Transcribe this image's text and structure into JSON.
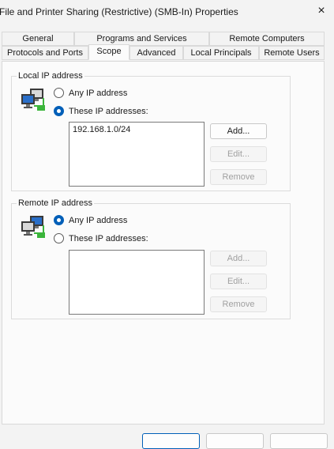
{
  "window": {
    "title": "File and Printer Sharing (Restrictive) (SMB-In) Properties"
  },
  "tabs_row1": [
    "General",
    "Programs and Services",
    "Remote Computers"
  ],
  "tabs_row2": [
    "Protocols and Ports",
    "Scope",
    "Advanced",
    "Local Principals",
    "Remote Users"
  ],
  "active_tab": "Scope",
  "local": {
    "legend": "Local IP address",
    "any_label": "Any IP address",
    "these_label": "These IP addresses:",
    "selected": "these",
    "addresses": [
      "192.168.1.0/24"
    ],
    "add": "Add...",
    "edit": "Edit...",
    "remove": "Remove"
  },
  "remote": {
    "legend": "Remote IP address",
    "any_label": "Any IP address",
    "these_label": "These IP addresses:",
    "selected": "any",
    "addresses": [],
    "add": "Add...",
    "edit": "Edit...",
    "remove": "Remove"
  },
  "colors": {
    "accent": "#005fb8",
    "panel": "#fbfbfb",
    "window": "#f3f3f3"
  },
  "icons": {
    "close": "×",
    "network": "network-computers-icon"
  }
}
